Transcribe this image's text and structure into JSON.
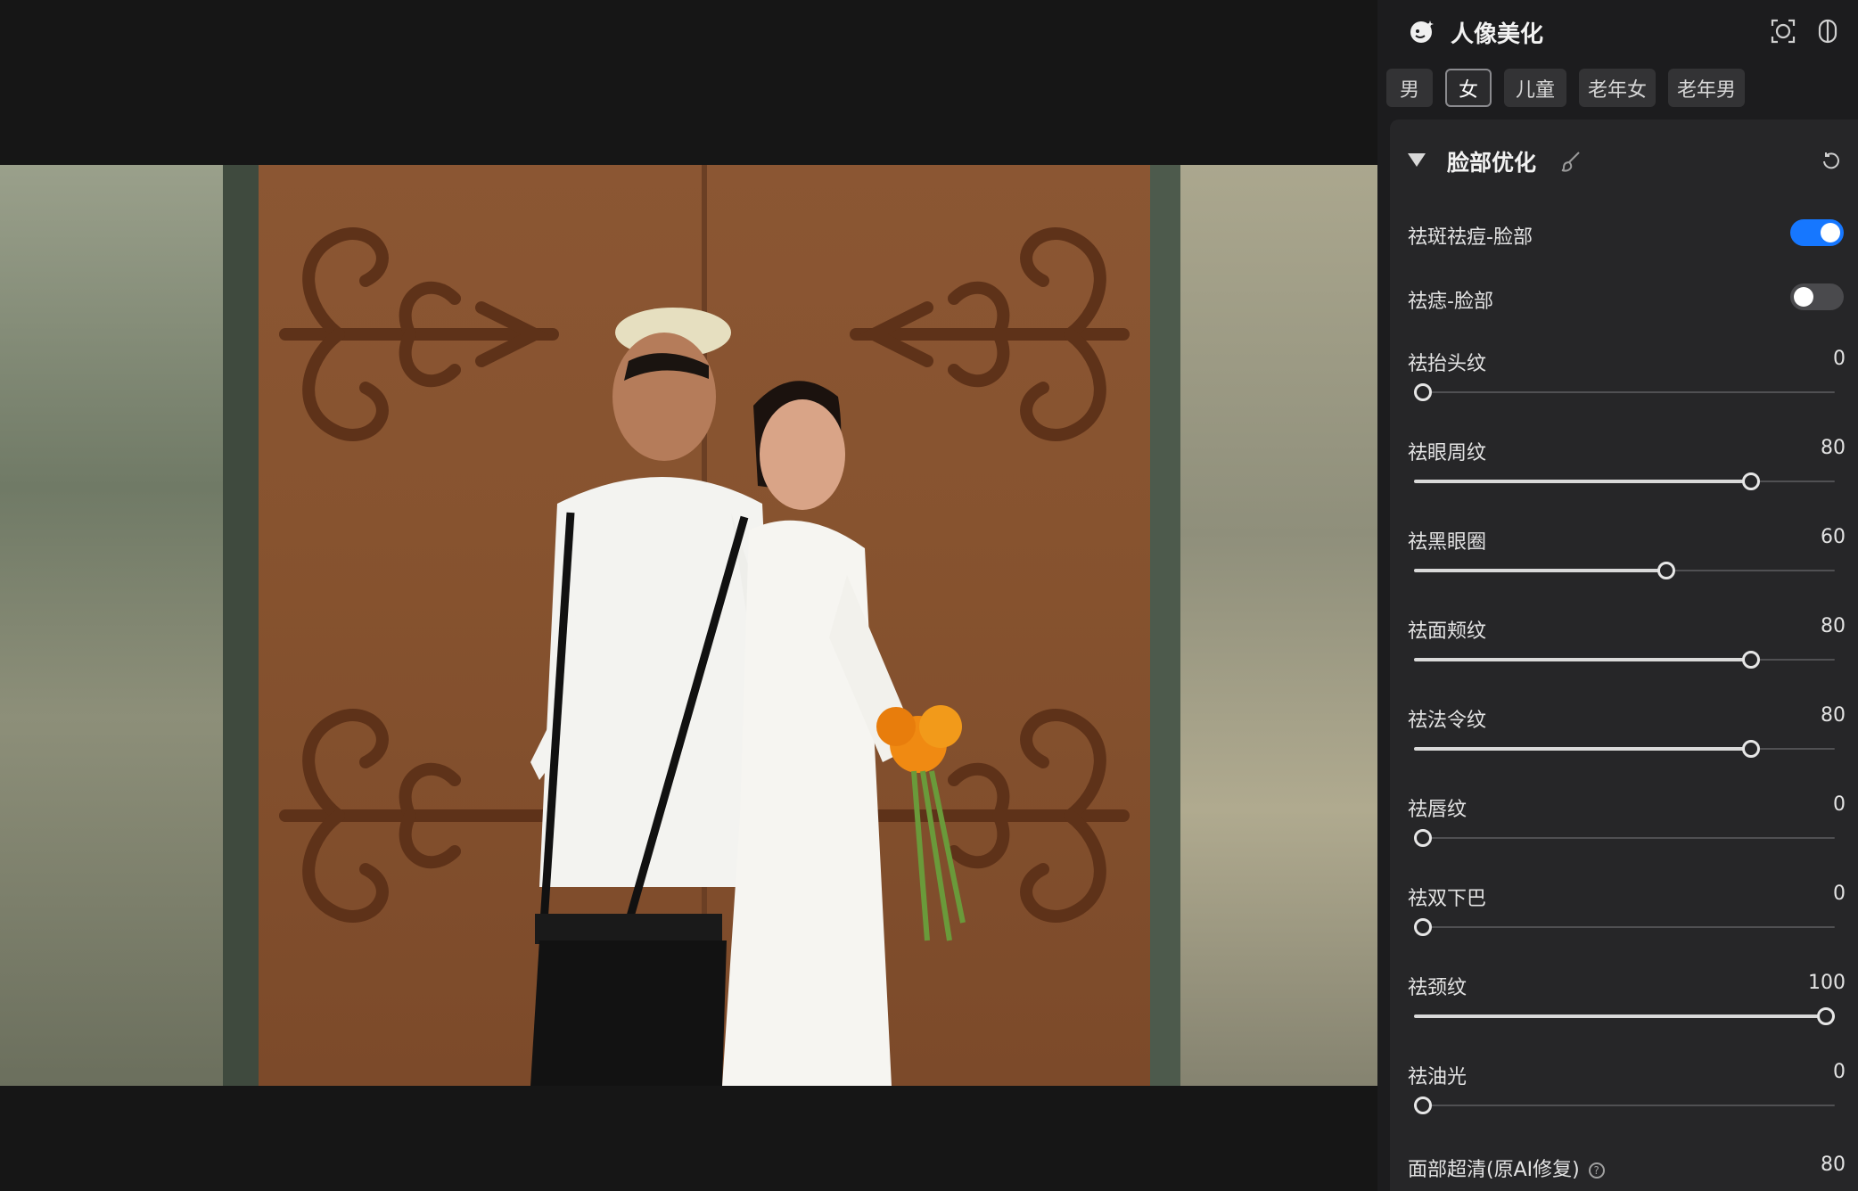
{
  "panel": {
    "title": "人像美化",
    "logo_icon": "portrait-beauty-icon",
    "header_icons": [
      "face-detect-icon",
      "compare-split-icon"
    ]
  },
  "chips": [
    {
      "label": "男",
      "active": false
    },
    {
      "label": "女",
      "active": true
    },
    {
      "label": "儿童",
      "active": false
    },
    {
      "label": "老年女",
      "active": false
    },
    {
      "label": "老年男",
      "active": false
    }
  ],
  "section": {
    "title": "脸部优化",
    "expanded": true,
    "icons": [
      "brush-icon",
      "reset-icon"
    ]
  },
  "toggles": [
    {
      "label": "祛斑祛痘-脸部",
      "on": true
    },
    {
      "label": "祛痣-脸部",
      "on": false
    }
  ],
  "sliders": [
    {
      "label": "祛抬头纹",
      "value": "0"
    },
    {
      "label": "祛眼周纹",
      "value": "80"
    },
    {
      "label": "祛黑眼圈",
      "value": "60"
    },
    {
      "label": "祛面颊纹",
      "value": "80"
    },
    {
      "label": "祛法令纹",
      "value": "80"
    },
    {
      "label": "祛唇纹",
      "value": "0"
    },
    {
      "label": "祛双下巴",
      "value": "0"
    },
    {
      "label": "祛颈纹",
      "value": "100"
    },
    {
      "label": "祛油光",
      "value": "0"
    }
  ],
  "last_row": {
    "label": "面部超清(原AI修复)",
    "value": "80",
    "icon": "help-icon"
  },
  "colors": {
    "accent": "#1677ff",
    "panel_bg": "#1c1c1e",
    "section_bg": "#262628",
    "canvas_bg": "#161616"
  }
}
